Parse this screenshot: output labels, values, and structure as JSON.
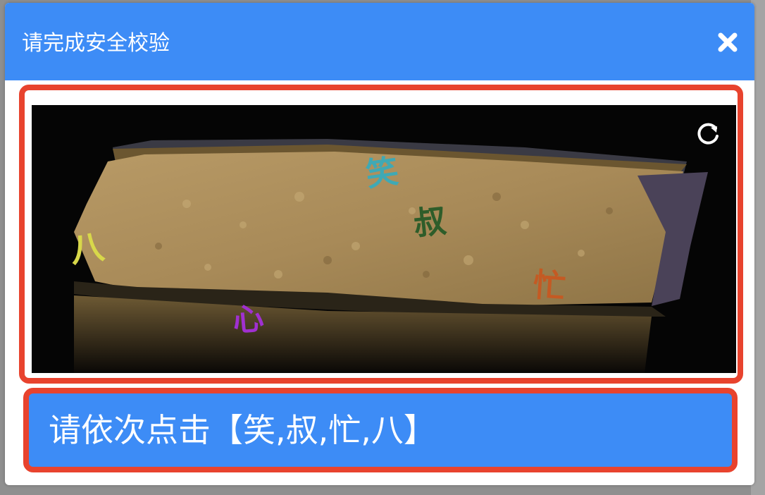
{
  "modal": {
    "title": "请完成安全校验",
    "close_icon": "close-icon",
    "refresh_icon": "refresh-icon"
  },
  "captcha": {
    "chars": [
      {
        "text": "笑",
        "color": "#3fa9b5"
      },
      {
        "text": "叔",
        "color": "#2e5d2a"
      },
      {
        "text": "八",
        "color": "#d8d84a"
      },
      {
        "text": "忙",
        "color": "#c45a23"
      },
      {
        "text": "心",
        "color": "#a030d0"
      }
    ],
    "instruction": "请依次点击【笑,叔,忙,八】"
  },
  "colors": {
    "header": "#3d8cf6",
    "highlight": "#e8432e"
  }
}
